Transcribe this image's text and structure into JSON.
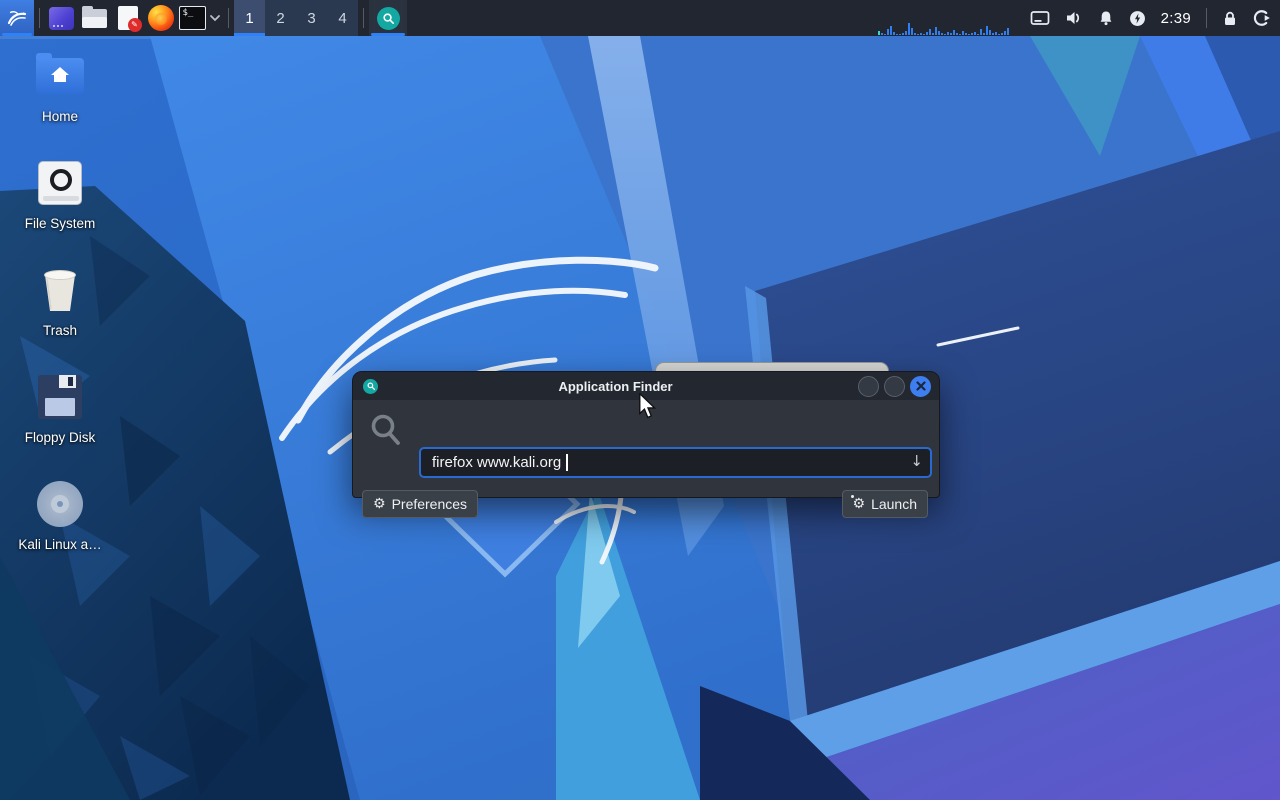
{
  "colors": {
    "panel_bg": "#212631",
    "accent_blue": "#2f81f7",
    "dialog_bg": "#30353d",
    "titlebar_bg": "#232830",
    "input_border": "#2a6ad0",
    "teal_icon": "#14a8a2",
    "close_button": "#3d7ff0",
    "wallpaper_base": "#2e6fd0"
  },
  "panel": {
    "workspaces": [
      "1",
      "2",
      "3",
      "4"
    ],
    "active_workspace": "1",
    "clock": "2:39",
    "terminal_glyph": "$_",
    "launcher_names": [
      "kali-menu",
      "window-app",
      "file-manager",
      "text-editor",
      "firefox",
      "terminal"
    ],
    "tray_names": [
      "display",
      "volume",
      "notifications",
      "power-manager",
      "clock",
      "lock-screen",
      "logout"
    ],
    "net_graph": {
      "bars": [
        4,
        2,
        1,
        6,
        9,
        3,
        1,
        1,
        2,
        4,
        12,
        7,
        2,
        1,
        2,
        1,
        3,
        6,
        2,
        8,
        4,
        2,
        1,
        3,
        2,
        5,
        2,
        1,
        4,
        2,
        1,
        2,
        3,
        1,
        6,
        2,
        9,
        5,
        2,
        3,
        1,
        2,
        4,
        7
      ],
      "bar_color": "#2f7ff0",
      "first_bar_color": "#35d6d0"
    }
  },
  "desktop": {
    "icons": [
      {
        "label": "Home"
      },
      {
        "label": "File System"
      },
      {
        "label": "Trash"
      },
      {
        "label": "Floppy Disk"
      },
      {
        "label": "Kali Linux a…"
      }
    ]
  },
  "finder": {
    "title": "Application Finder",
    "search_value": "firefox www.kali.org",
    "preferences_label": "Preferences",
    "launch_label": "Launch",
    "icons": {
      "gear": "⚙",
      "dropdown_arrow": "↓",
      "editor_badge": "✎"
    }
  }
}
